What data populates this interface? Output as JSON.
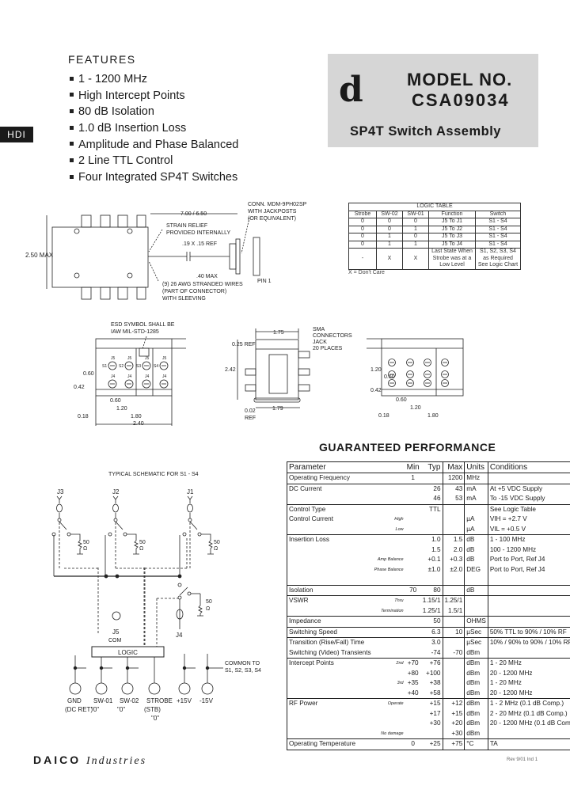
{
  "side_tab": "HDI",
  "features": {
    "title": "FEATURES",
    "items": [
      "1 - 1200 MHz",
      "High Intercept Points",
      "80 dB Isolation",
      "1.0 dB Insertion Loss",
      "Amplitude and Phase Balanced",
      "2 Line TTL Control",
      "Four Integrated SP4T Switches"
    ]
  },
  "model": {
    "logo": "d",
    "label": "MODEL NO.",
    "number": "CSA09034",
    "description": "SP4T Switch Assembly",
    "box_color": "#d6d6d6"
  },
  "outline_drawing": {
    "height_dim": "2.50 MAX",
    "cable_length": "7.00 / 6.50",
    "connector": [
      "CONN. MDM-9PH02SP",
      "WITH JACKPOSTS",
      "(OR EQUIVALENT)"
    ],
    "strain_relief": [
      "STRAIN RELIEF",
      "PROVIDED INTERNALLY"
    ],
    "cable_ref": ".19 X .15 REF",
    "connector_depth": ".40 MAX",
    "wires": [
      "(9) 26 AWG STRANDED WIRES",
      "(PART OF CONNECTOR)",
      "WITH SLEEVING"
    ],
    "pin": "PIN 1"
  },
  "logic_table": {
    "title": "LOGIC TABLE",
    "headers": [
      "Strobe",
      "SW-02",
      "SW-01",
      "Function",
      "Switch"
    ],
    "rows": [
      [
        "0",
        "0",
        "0",
        "J5 To J1",
        "S1 - S4"
      ],
      [
        "0",
        "0",
        "1",
        "J5 To J2",
        "S1 - S4"
      ],
      [
        "0",
        "1",
        "0",
        "J5 To J3",
        "S1 - S4"
      ],
      [
        "0",
        "1",
        "1",
        "J5 To J4",
        "S1 - S4"
      ],
      [
        "-",
        "X",
        "X",
        "Last State When Strobe was at a Low Level",
        "S1, S2, S3, S4 as Required See Logic Chart"
      ]
    ],
    "note": "X = Don't Care"
  },
  "views": {
    "top": {
      "esd": [
        "ESD SYMBOL SHALL BE",
        "IAW MIL-STD-1285"
      ],
      "dims": [
        "0.60",
        "0.42",
        "0.60",
        "1.20",
        "1.80",
        "2.40",
        "0.18"
      ],
      "ports_top": [
        "J5",
        "J5",
        "J5",
        "J5"
      ],
      "switches": [
        "S1",
        "S2",
        "S3",
        "S4"
      ],
      "ports_bottom": [
        "J4",
        "J4",
        "J4",
        "J4"
      ]
    },
    "side": {
      "dims": [
        "1.75",
        "0.25 REF",
        "2.42",
        "0.02",
        "REF",
        "1.79"
      ],
      "sma": [
        "SMA",
        "CONNECTORS",
        "JACK",
        "20 PLACES"
      ]
    },
    "bottom": {
      "dims": [
        "1.20",
        "0.60",
        "0.42",
        "0.60",
        "1.20",
        "1.80",
        "0.18"
      ]
    }
  },
  "schematic": {
    "title": "TYPICAL SCHEMATIC FOR S1 - S4",
    "ports": [
      "J3",
      "J2",
      "J1"
    ],
    "load": "50",
    "ohm": "Ω",
    "com_port": "J5",
    "com_label": "COM",
    "j4": "J4",
    "logic": "LOGIC",
    "common_note": [
      "COMMON TO",
      "S1, S2, S3, S4"
    ],
    "pins": [
      {
        "name": "GND",
        "sub": "(DC RET)",
        "sub2": ""
      },
      {
        "name": "SW-01",
        "sub": "\"0\"",
        "sub2": ""
      },
      {
        "name": "SW-02",
        "sub": "\"0\"",
        "sub2": ""
      },
      {
        "name": "STROBE",
        "sub": "(STB)",
        "sub2": "\"0\""
      },
      {
        "name": "+15V",
        "sub": "",
        "sub2": ""
      },
      {
        "name": "-15V",
        "sub": "",
        "sub2": ""
      }
    ]
  },
  "performance": {
    "title": "GUARANTEED PERFORMANCE",
    "headers": [
      "Parameter",
      "",
      "Min",
      "Typ",
      "Max",
      "Units",
      "Conditions"
    ],
    "rows": [
      {
        "sep": true,
        "p": "Operating Frequency",
        "s": "",
        "min": "1",
        "typ": "",
        "max": "1200",
        "u": "MHz",
        "c": ""
      },
      {
        "sep": true,
        "p": "DC Current",
        "s": "",
        "min": "",
        "typ": "26",
        "max": "43",
        "u": "mA",
        "c": "At +5 VDC Supply"
      },
      {
        "sep": false,
        "p": "",
        "s": "",
        "min": "",
        "typ": "46",
        "max": "53",
        "u": "mA",
        "c": "To -15 VDC Supply"
      },
      {
        "sep": true,
        "p": "Control Type",
        "s": "",
        "min": "",
        "typ": "TTL",
        "max": "",
        "u": "",
        "c": "See Logic Table"
      },
      {
        "sep": false,
        "p": "Control Current",
        "s": "High",
        "min": "",
        "typ": "",
        "max": "",
        "u": "µA",
        "c": "VIH = +2.7 V"
      },
      {
        "sep": false,
        "p": "",
        "s": "Low",
        "min": "",
        "typ": "",
        "max": "",
        "u": "µA",
        "c": "VIL = +0.5 V"
      },
      {
        "sep": true,
        "p": "Insertion Loss",
        "s": "",
        "min": "",
        "typ": "1.0",
        "max": "1.5",
        "u": "dB",
        "c": "1 - 100 MHz"
      },
      {
        "sep": false,
        "p": "",
        "s": "",
        "min": "",
        "typ": "1.5",
        "max": "2.0",
        "u": "dB",
        "c": "100 - 1200 MHz"
      },
      {
        "sep": false,
        "p": "",
        "s": "Amp Balance",
        "min": "",
        "typ": "+0.1",
        "max": "+0.3",
        "u": "dB",
        "c": "Port to Port, Ref J4"
      },
      {
        "sep": false,
        "p": "",
        "s": "Phase Balance",
        "min": "",
        "typ": "±1.0",
        "max": "±2.0",
        "u": "DEG",
        "c": "Port to Port, Ref J4"
      },
      {
        "sep": false,
        "p": "",
        "s": "",
        "min": "",
        "typ": "",
        "max": "",
        "u": "",
        "c": ""
      },
      {
        "sep": true,
        "p": "Isolation",
        "s": "",
        "min": "70",
        "typ": "80",
        "max": "",
        "u": "dB",
        "c": ""
      },
      {
        "sep": true,
        "p": "VSWR",
        "s": "Thru",
        "min": "",
        "typ": "1.15/1",
        "max": "1.25/1",
        "u": "",
        "c": ""
      },
      {
        "sep": false,
        "p": "",
        "s": "Termination",
        "min": "",
        "typ": "1.25/1",
        "max": "1.5/1",
        "u": "",
        "c": ""
      },
      {
        "sep": true,
        "p": "Impedance",
        "s": "",
        "min": "",
        "typ": "50",
        "max": "",
        "u": "OHMS",
        "c": ""
      },
      {
        "sep": true,
        "p": "Switching Speed",
        "s": "",
        "min": "",
        "typ": "6.3",
        "max": "10",
        "u": "µSec",
        "c": "50% TTL to 90% / 10% RF"
      },
      {
        "sep": true,
        "p": "Transition (Rise/Fall) Time",
        "s": "",
        "min": "",
        "typ": "3.0",
        "max": "",
        "u": "µSec",
        "c": "10% / 90% to 90% / 10% RF"
      },
      {
        "sep": false,
        "p": "Switching (Video) Transients",
        "s": "",
        "min": "",
        "typ": "-74",
        "max": "-70",
        "u": "dBm",
        "c": ""
      },
      {
        "sep": true,
        "p": "Intercept Points",
        "s": "2nd",
        "min": "+70",
        "typ": "+76",
        "max": "",
        "u": "dBm",
        "c": "1 - 20 MHz"
      },
      {
        "sep": false,
        "p": "",
        "s": "",
        "min": "+80",
        "typ": "+100",
        "max": "",
        "u": "dBm",
        "c": "20 - 1200 MHz"
      },
      {
        "sep": false,
        "p": "",
        "s": "3rd",
        "min": "+35",
        "typ": "+38",
        "max": "",
        "u": "dBm",
        "c": "1 - 20 MHz"
      },
      {
        "sep": false,
        "p": "",
        "s": "",
        "min": "+40",
        "typ": "+58",
        "max": "",
        "u": "dBm",
        "c": "20 - 1200 MHz"
      },
      {
        "sep": true,
        "p": "RF Power",
        "s": "Operate",
        "min": "",
        "typ": "+15",
        "max": "+12",
        "u": "dBm",
        "c": "1 - 2 MHz (0.1 dB Comp.)"
      },
      {
        "sep": false,
        "p": "",
        "s": "",
        "min": "",
        "typ": "+17",
        "max": "+15",
        "u": "dBm",
        "c": "2 - 20 MHz (0.1 dB Comp.)"
      },
      {
        "sep": false,
        "p": "",
        "s": "",
        "min": "",
        "typ": "+30",
        "max": "+20",
        "u": "dBm",
        "c": "20 - 1200 MHz (0.1 dB Comp.)"
      },
      {
        "sep": false,
        "p": "",
        "s": "No damage",
        "min": "",
        "typ": "",
        "max": "+30",
        "u": "dBm",
        "c": ""
      },
      {
        "sep": true,
        "p": "Operating Temperature",
        "s": "",
        "min": "0",
        "typ": "+25",
        "max": "+75",
        "u": "°C",
        "c": "TA"
      }
    ]
  },
  "footer": {
    "brand": "DAICO",
    "brand_script": "Industries",
    "rev": "Rev 9/01 Ind 1"
  }
}
